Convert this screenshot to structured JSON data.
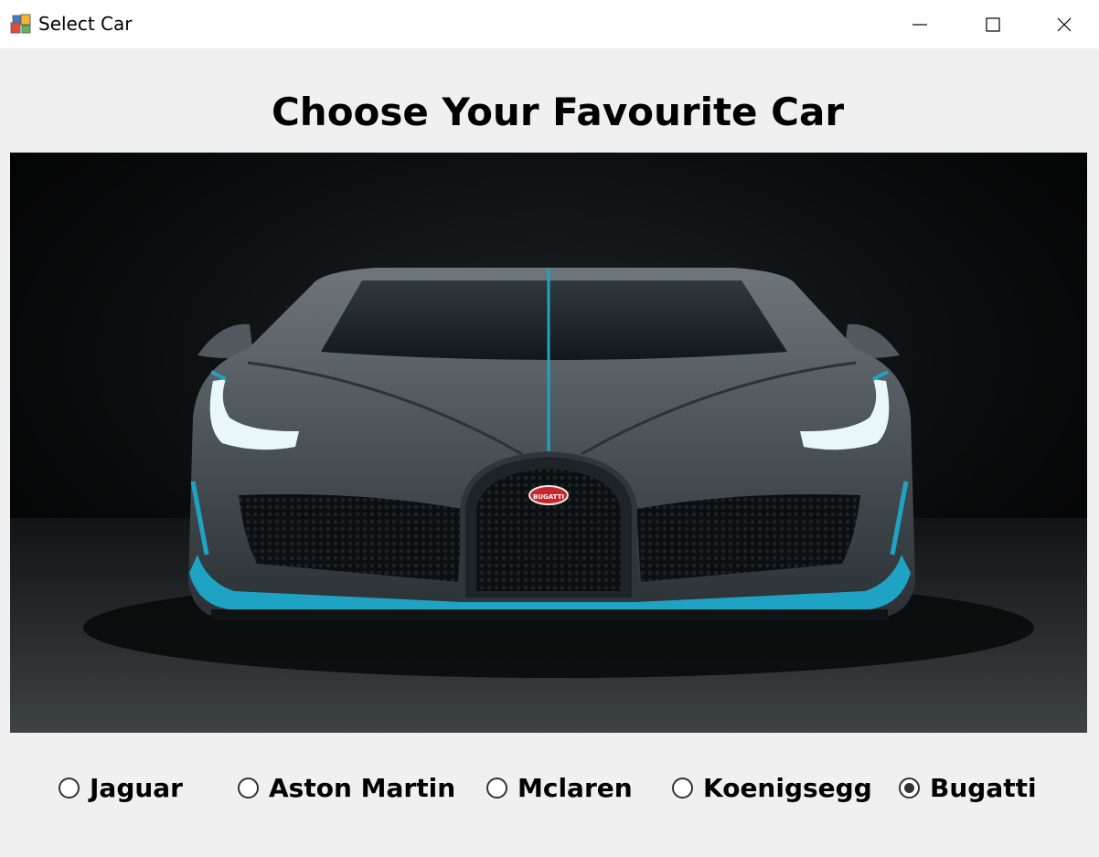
{
  "window": {
    "title": "Select Car",
    "icon": "winforms-app-icon",
    "controls": [
      "minimize-icon",
      "maximize-icon",
      "close-icon"
    ]
  },
  "main": {
    "heading": "Choose Your Favourite Car",
    "image": {
      "subject": "Bugatti Divo front view",
      "badge_text": "BUGATTI",
      "colors": {
        "body": "#4a5257",
        "accent": "#1fa3c4",
        "background": "#050505"
      }
    }
  },
  "options": [
    {
      "label": "Jaguar",
      "checked": false
    },
    {
      "label": "Aston Martin",
      "checked": false
    },
    {
      "label": "Mclaren",
      "checked": false
    },
    {
      "label": "Koenigsegg",
      "checked": false
    },
    {
      "label": "Bugatti",
      "checked": true
    }
  ],
  "selected": "Bugatti"
}
